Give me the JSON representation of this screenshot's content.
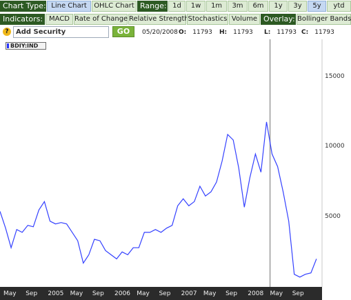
{
  "toolbar": {
    "chart_type_label": "Chart Type:",
    "chart_types": [
      "Line Chart",
      "OHLC Chart"
    ],
    "range_label": "Range:",
    "ranges": [
      "1d",
      "1w",
      "1m",
      "3m",
      "6m",
      "1y",
      "3y",
      "5y",
      "ytd"
    ],
    "indicators_label": "Indicators:",
    "indicators": [
      "MACD",
      "Rate of Change",
      "Relative Strength",
      "Stochastics",
      "Volume"
    ],
    "overlay_label": "Overlay:",
    "overlays": [
      "Bollinger Bands"
    ]
  },
  "controls": {
    "help": "?",
    "security_value": "Add Security",
    "go": "GO",
    "date": "05/20/2008",
    "o_label": "O:",
    "o_value": "11793",
    "h_label": "H:",
    "h_value": "11793",
    "l_label": "L:",
    "l_value": "11793",
    "c_label": "C:",
    "c_value": "11793"
  },
  "chart_data": {
    "type": "line",
    "legend": "BDIY:IND",
    "x_ticks": [
      "May",
      "Sep",
      "2005",
      "May",
      "Sep",
      "2006",
      "May",
      "Sep",
      "2007",
      "May",
      "Sep",
      "2008",
      "May",
      "Sep"
    ],
    "y_ticks": [
      "15000",
      "10000",
      "5000"
    ],
    "ylim": [
      0,
      17700
    ],
    "cursor_date": "05/20/2008",
    "series": [
      {
        "color": "#3340ff",
        "points": [
          [
            "2004-05",
            5400
          ],
          [
            "2004-06",
            4200
          ],
          [
            "2004-07",
            2800
          ],
          [
            "2004-08",
            4100
          ],
          [
            "2004-09",
            3900
          ],
          [
            "2004-10",
            4400
          ],
          [
            "2004-11",
            4300
          ],
          [
            "2004-12",
            5500
          ],
          [
            "2005-01",
            6100
          ],
          [
            "2005-02",
            4700
          ],
          [
            "2005-03",
            4500
          ],
          [
            "2005-04",
            4600
          ],
          [
            "2005-05",
            4500
          ],
          [
            "2005-06",
            3900
          ],
          [
            "2005-07",
            3300
          ],
          [
            "2005-08",
            1700
          ],
          [
            "2005-09",
            2300
          ],
          [
            "2005-10",
            3400
          ],
          [
            "2005-11",
            3300
          ],
          [
            "2005-12",
            2600
          ],
          [
            "2006-01",
            2300
          ],
          [
            "2006-02",
            2000
          ],
          [
            "2006-03",
            2500
          ],
          [
            "2006-04",
            2300
          ],
          [
            "2006-05",
            2800
          ],
          [
            "2006-06",
            2800
          ],
          [
            "2006-07",
            3900
          ],
          [
            "2006-08",
            3900
          ],
          [
            "2006-09",
            4100
          ],
          [
            "2006-10",
            3900
          ],
          [
            "2006-11",
            4200
          ],
          [
            "2006-12",
            4400
          ],
          [
            "2007-01",
            5800
          ],
          [
            "2007-02",
            6300
          ],
          [
            "2007-03",
            5800
          ],
          [
            "2007-04",
            6100
          ],
          [
            "2007-05",
            7200
          ],
          [
            "2007-06",
            6500
          ],
          [
            "2007-07",
            6800
          ],
          [
            "2007-08",
            7500
          ],
          [
            "2007-09",
            9000
          ],
          [
            "2007-10",
            10900
          ],
          [
            "2007-11",
            10500
          ],
          [
            "2007-12",
            8500
          ],
          [
            "2008-01",
            5700
          ],
          [
            "2008-02",
            7800
          ],
          [
            "2008-03",
            9500
          ],
          [
            "2008-04",
            8200
          ],
          [
            "2008-05",
            11793
          ],
          [
            "2008-06",
            9500
          ],
          [
            "2008-07",
            8600
          ],
          [
            "2008-08",
            6800
          ],
          [
            "2008-09",
            4700
          ],
          [
            "2008-10",
            900
          ],
          [
            "2008-11",
            700
          ],
          [
            "2008-12",
            900
          ],
          [
            "2009-01",
            1000
          ],
          [
            "2009-02",
            2000
          ]
        ]
      }
    ]
  }
}
